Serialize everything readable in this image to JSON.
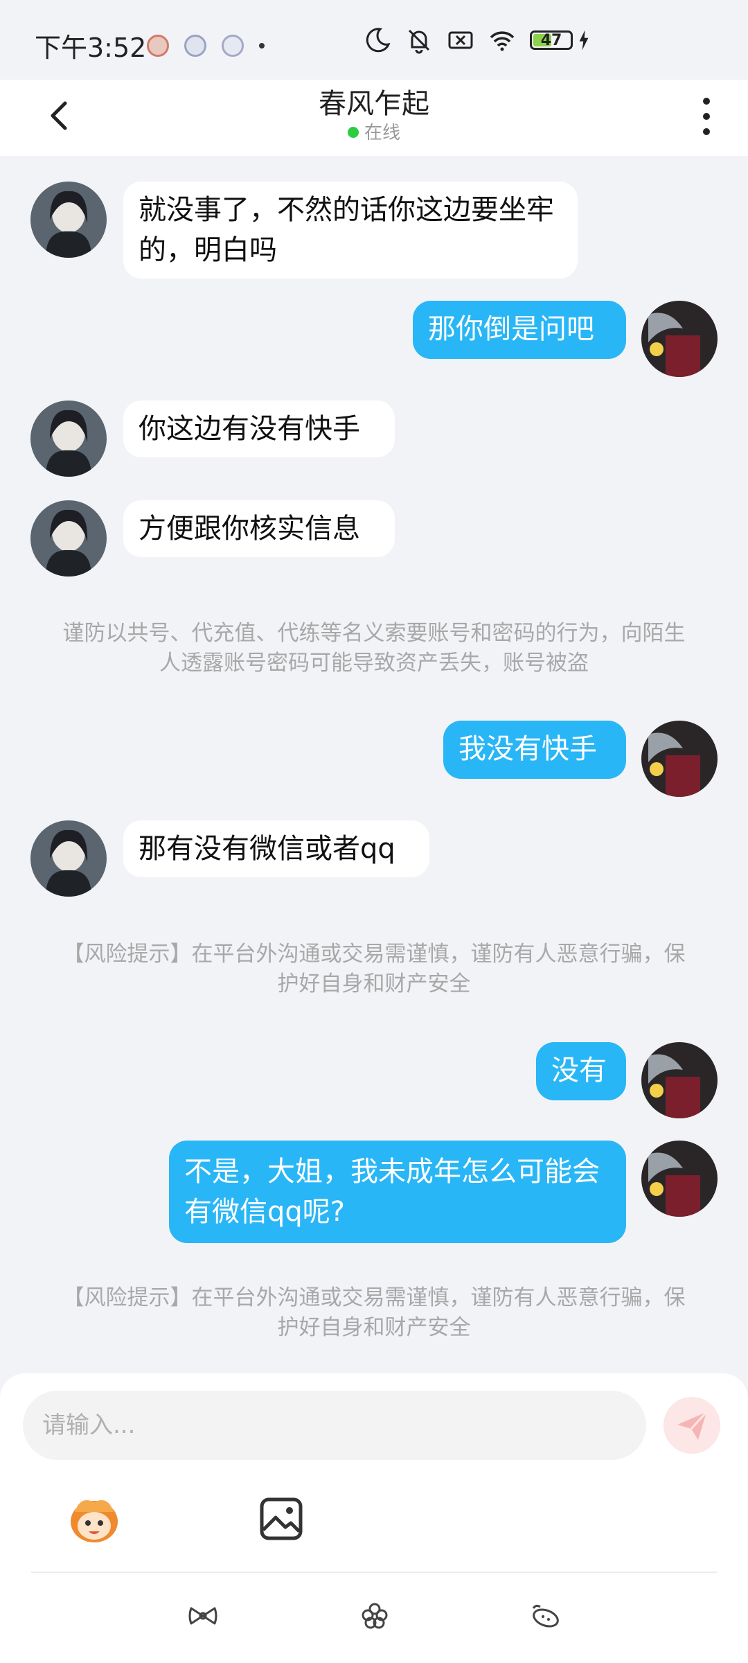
{
  "status_bar": {
    "time": "下午3:52",
    "battery": "47"
  },
  "header": {
    "title": "春风乍起",
    "status": "在线"
  },
  "messages": [
    {
      "side": "in",
      "text": "就没事了，不然的话你这边要坐牢的，明白吗"
    },
    {
      "side": "out",
      "text": "那你倒是问吧"
    },
    {
      "side": "in",
      "text": "你这边有没有快手"
    },
    {
      "side": "in",
      "text": "方便跟你核实信息"
    },
    {
      "side": "out",
      "text": "我没有快手"
    },
    {
      "side": "in",
      "text": "那有没有微信或者qq"
    },
    {
      "side": "out",
      "text": "没有"
    },
    {
      "side": "out",
      "text": "不是，大姐，我未成年怎么可能会有微信qq呢?"
    }
  ],
  "notices": [
    "谨防以共号、代充值、代练等名义索要账号和密码的行为，向陌生人透露账号密码可能导致资产丢失，账号被盗",
    "【风险提示】在平台外沟通或交易需谨慎，谨防有人恶意行骗，保护好自身和财产安全",
    "【风险提示】在平台外沟通或交易需谨慎，谨防有人恶意行骗，保护好自身和财产安全"
  ],
  "composer": {
    "placeholder": "请输入..."
  },
  "colors": {
    "out_bubble": "#29b6f6",
    "in_bubble": "#ffffff",
    "background": "#f2f3f7",
    "online": "#2ecc40"
  }
}
